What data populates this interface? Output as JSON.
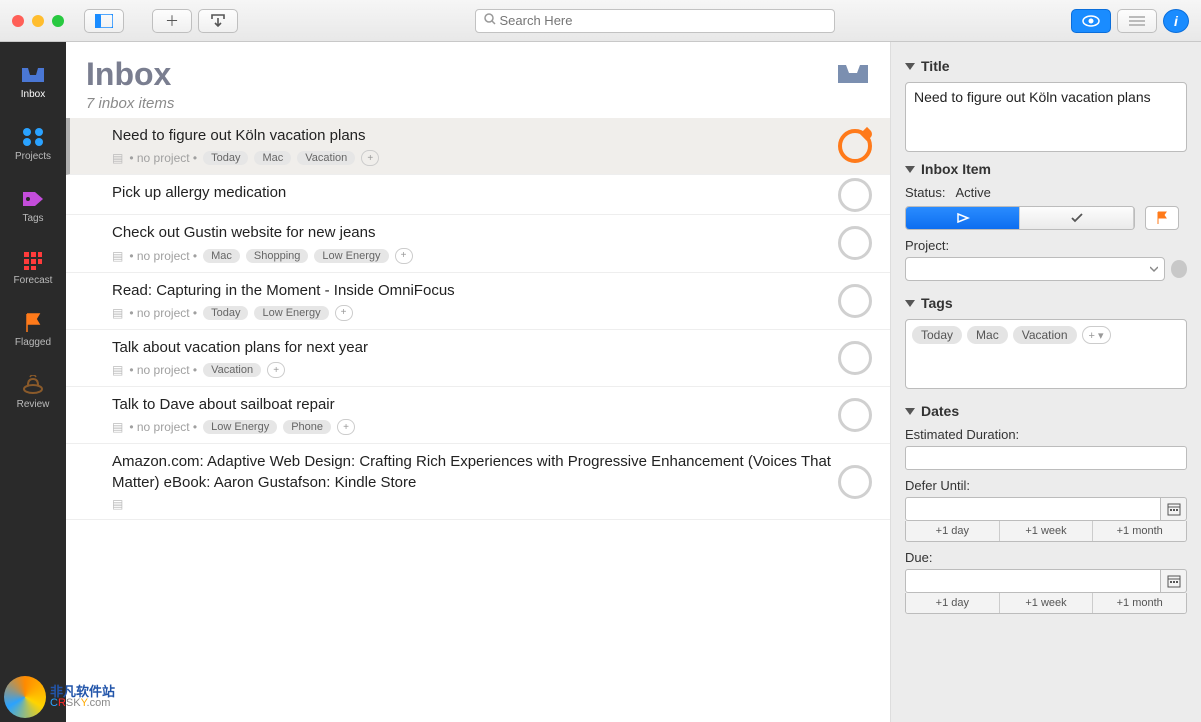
{
  "toolbar": {
    "search_placeholder": "Search Here"
  },
  "sidebar": {
    "items": [
      {
        "label": "Inbox",
        "icon": "inbox",
        "color": "#4a77d4",
        "active": true
      },
      {
        "label": "Projects",
        "icon": "projects",
        "color": "#2aa2ff",
        "active": false
      },
      {
        "label": "Tags",
        "icon": "tag",
        "color": "#c44ddb",
        "active": false
      },
      {
        "label": "Forecast",
        "icon": "forecast",
        "color": "#ff3b3b",
        "active": false
      },
      {
        "label": "Flagged",
        "icon": "flag",
        "color": "#ff7a1a",
        "active": false
      },
      {
        "label": "Review",
        "icon": "review",
        "color": "#8a5a2a",
        "active": false
      }
    ]
  },
  "main": {
    "title": "Inbox",
    "subtitle": "7 inbox items",
    "tasks": [
      {
        "title": "Need to figure out Köln vacation plans",
        "no_project": "no project",
        "tags": [
          "Today",
          "Mac",
          "Vacation"
        ],
        "selected": true,
        "has_note": true
      },
      {
        "title": "Pick up allergy medication",
        "no_project": null,
        "tags": [],
        "selected": false,
        "has_note": false
      },
      {
        "title": "Check out Gustin website for new jeans",
        "no_project": "no project",
        "tags": [
          "Mac",
          "Shopping",
          "Low Energy"
        ],
        "selected": false,
        "has_note": true
      },
      {
        "title": "Read: Capturing in the Moment - Inside OmniFocus",
        "no_project": "no project",
        "tags": [
          "Today",
          "Low Energy"
        ],
        "selected": false,
        "has_note": true
      },
      {
        "title": "Talk about vacation plans for next year",
        "no_project": "no project",
        "tags": [
          "Vacation"
        ],
        "selected": false,
        "has_note": true
      },
      {
        "title": "Talk to Dave about sailboat repair",
        "no_project": "no project",
        "tags": [
          "Low Energy",
          "Phone"
        ],
        "selected": false,
        "has_note": true
      },
      {
        "title": "Amazon.com: Adaptive Web Design: Crafting Rich Experiences with Progressive Enhancement (Voices That Matter) eBook: Aaron Gustafson: Kindle Store",
        "no_project": null,
        "tags": [],
        "selected": false,
        "has_note": true
      }
    ]
  },
  "inspector": {
    "title_section": "Title",
    "title_value": "Need to figure out Köln vacation plans",
    "inbox_item_section": "Inbox Item",
    "status_label": "Status:",
    "status_value": "Active",
    "project_label": "Project:",
    "project_value": "",
    "tags_section": "Tags",
    "tags": [
      "Today",
      "Mac",
      "Vacation"
    ],
    "dates_section": "Dates",
    "estimated_label": "Estimated Duration:",
    "estimated_value": "",
    "defer_label": "Defer Until:",
    "defer_value": "",
    "due_label": "Due:",
    "due_value": "",
    "quick": {
      "day": "+1 day",
      "week": "+1 week",
      "month": "+1 month"
    }
  },
  "watermark": {
    "cn": "非凡软件站",
    "en": "CRSKY.com"
  }
}
